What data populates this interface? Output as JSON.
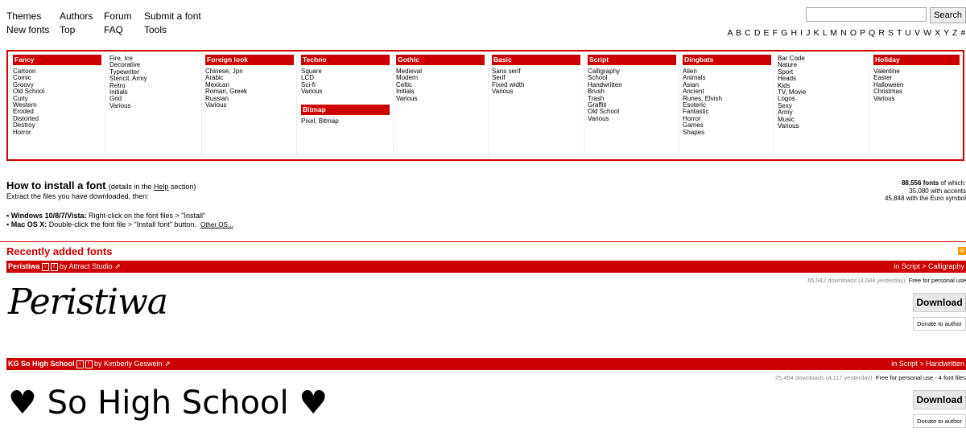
{
  "nav": {
    "row1": [
      "Themes",
      "Authors",
      "Forum",
      "Submit a font"
    ],
    "row2": [
      "New fonts",
      "Top",
      "FAQ",
      "Tools"
    ]
  },
  "search": {
    "button_label": "Search",
    "value": ""
  },
  "alphabet": "A B C D E F G H I J K L M N O P Q R S T U V W X Y Z #",
  "categories": [
    {
      "header": "Fancy",
      "items": [
        "Cartoon",
        "Comic",
        "Groovy",
        "Old School",
        "Curly",
        "Western",
        "Eroded",
        "Distorted",
        "Destroy",
        "Horror"
      ]
    },
    {
      "header": "",
      "items": [
        "Fire, Ice",
        "Decorative",
        "Typewriter",
        "Stencil, Army",
        "Retro",
        "Initials",
        "Grid",
        "Various"
      ]
    },
    {
      "header": "Foreign look",
      "items": [
        "Chinese, Jpn",
        "Arabic",
        "Mexican",
        "Roman, Greek",
        "Russian",
        "Various"
      ]
    },
    {
      "header": "Techno",
      "items": [
        "Square",
        "LCD",
        "Sci-fi",
        "Various"
      ],
      "header2": "Bitmap",
      "items2": [
        "Pixel, Bitmap"
      ]
    },
    {
      "header": "Gothic",
      "items": [
        "Medieval",
        "Modern",
        "Celtic",
        "Initials",
        "Various"
      ]
    },
    {
      "header": "Basic",
      "items": [
        "Sans serif",
        "Serif",
        "Fixed width",
        "Various"
      ]
    },
    {
      "header": "Script",
      "items": [
        "Calligraphy",
        "School",
        "Handwritten",
        "Brush",
        "Trash",
        "Graffiti",
        "Old School",
        "Various"
      ]
    },
    {
      "header": "Dingbats",
      "items": [
        "Alien",
        "Animals",
        "Asian",
        "Ancient",
        "Runes, Elvish",
        "Esoteric",
        "Fantastic",
        "Horror",
        "Games",
        "Shapes"
      ]
    },
    {
      "header": "",
      "items": [
        "Bar Code",
        "Nature",
        "Sport",
        "Heads",
        "Kids",
        "TV, Movie",
        "Logos",
        "Sexy",
        "Army",
        "Music",
        "Various"
      ]
    },
    {
      "header": "Holiday",
      "items": [
        "Valentine",
        "Easter",
        "Halloween",
        "Christmas",
        "Various"
      ]
    }
  ],
  "install": {
    "title": "How to install a font",
    "subtitle_pre": "(details in the ",
    "subtitle_link": "Help",
    "subtitle_post": " section)",
    "extract": "Extract the files you have downloaded, then:",
    "windows_label": "Windows 10/8/7/Vista:",
    "windows_text": " Right-click on the font files > \"Install\"",
    "mac_label": "Mac OS X:",
    "mac_text": " Double-click the font file > \"Install font\" button.",
    "other_os": "Other OS..."
  },
  "stats": {
    "count": "88,556 fonts",
    "of_which": " of which:",
    "accents": "35,080 with accents",
    "euro": "45,848 with the Euro symbol"
  },
  "recent_title": "Recently added fonts",
  "fonts": [
    {
      "name": "Peristiwa",
      "by": "by Attract Studio",
      "category": "in Script > Calligraphy",
      "downloads": "65,942 downloads (4,684 yesterday)",
      "license": "Free for personal use",
      "download_label": "Download",
      "donate_label": "Donate to author",
      "preview": "Peristiwa"
    },
    {
      "name": "KG So High School",
      "by": "by Kimberly Geswein",
      "category": "in Script > Handwritten",
      "downloads": "25,454 downloads (4,117 yesterday)",
      "license": "Free for personal use - 4 font files",
      "download_label": "Download",
      "donate_label": "Donate to author",
      "preview": "♥ So High School ♥"
    }
  ]
}
